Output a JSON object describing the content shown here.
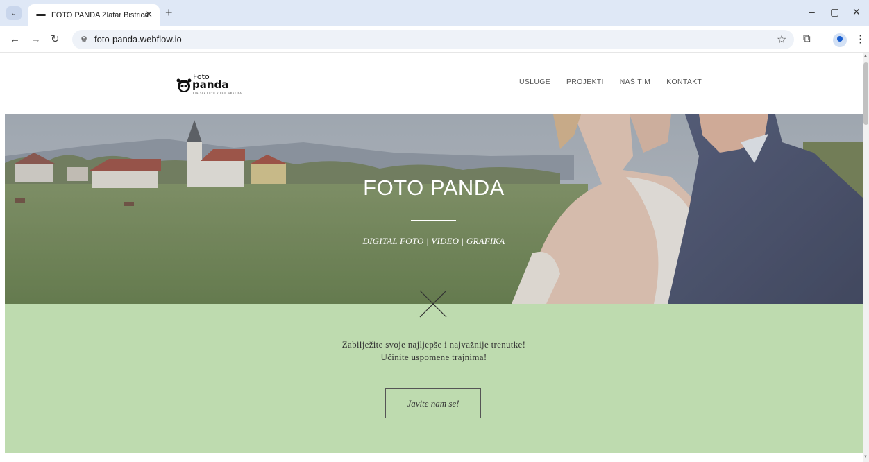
{
  "browser": {
    "tab_title": "FOTO PANDA Zlatar Bistrica",
    "tab_close": "✕",
    "new_tab": "+",
    "url": "foto-panda.webflow.io",
    "window_controls": [
      "–",
      "▢",
      "✕"
    ],
    "icons": [
      "tab-search-icon",
      "back-arrow-icon",
      "forward-arrow-icon",
      "reload-icon",
      "site-info-icon",
      "bookmark-star-icon",
      "extensions-icon",
      "profile-icon",
      "menu-dots-icon"
    ]
  },
  "site": {
    "logo": {
      "foto": "Foto",
      "panda": "panda",
      "tagline": "DIGITAL FOTO VIDEO GRAFIKA"
    },
    "nav": [
      "USLUGE",
      "PROJEKTI",
      "NAŠ TIM",
      "KONTAKT"
    ],
    "hero": {
      "title": "FOTO PANDA",
      "subtitle": "DIGITAL FOTO | VIDEO | GRAFIKA"
    },
    "intro": {
      "line1": "Zabilježite svoje najljepše i najvažnije trenutke!",
      "line2": "Učinite uspomene trajnima!"
    },
    "cta_label": "Javite nam se!"
  },
  "colors": {
    "green_section": "#bedbaf",
    "tabbar": "#dfe8f6"
  }
}
